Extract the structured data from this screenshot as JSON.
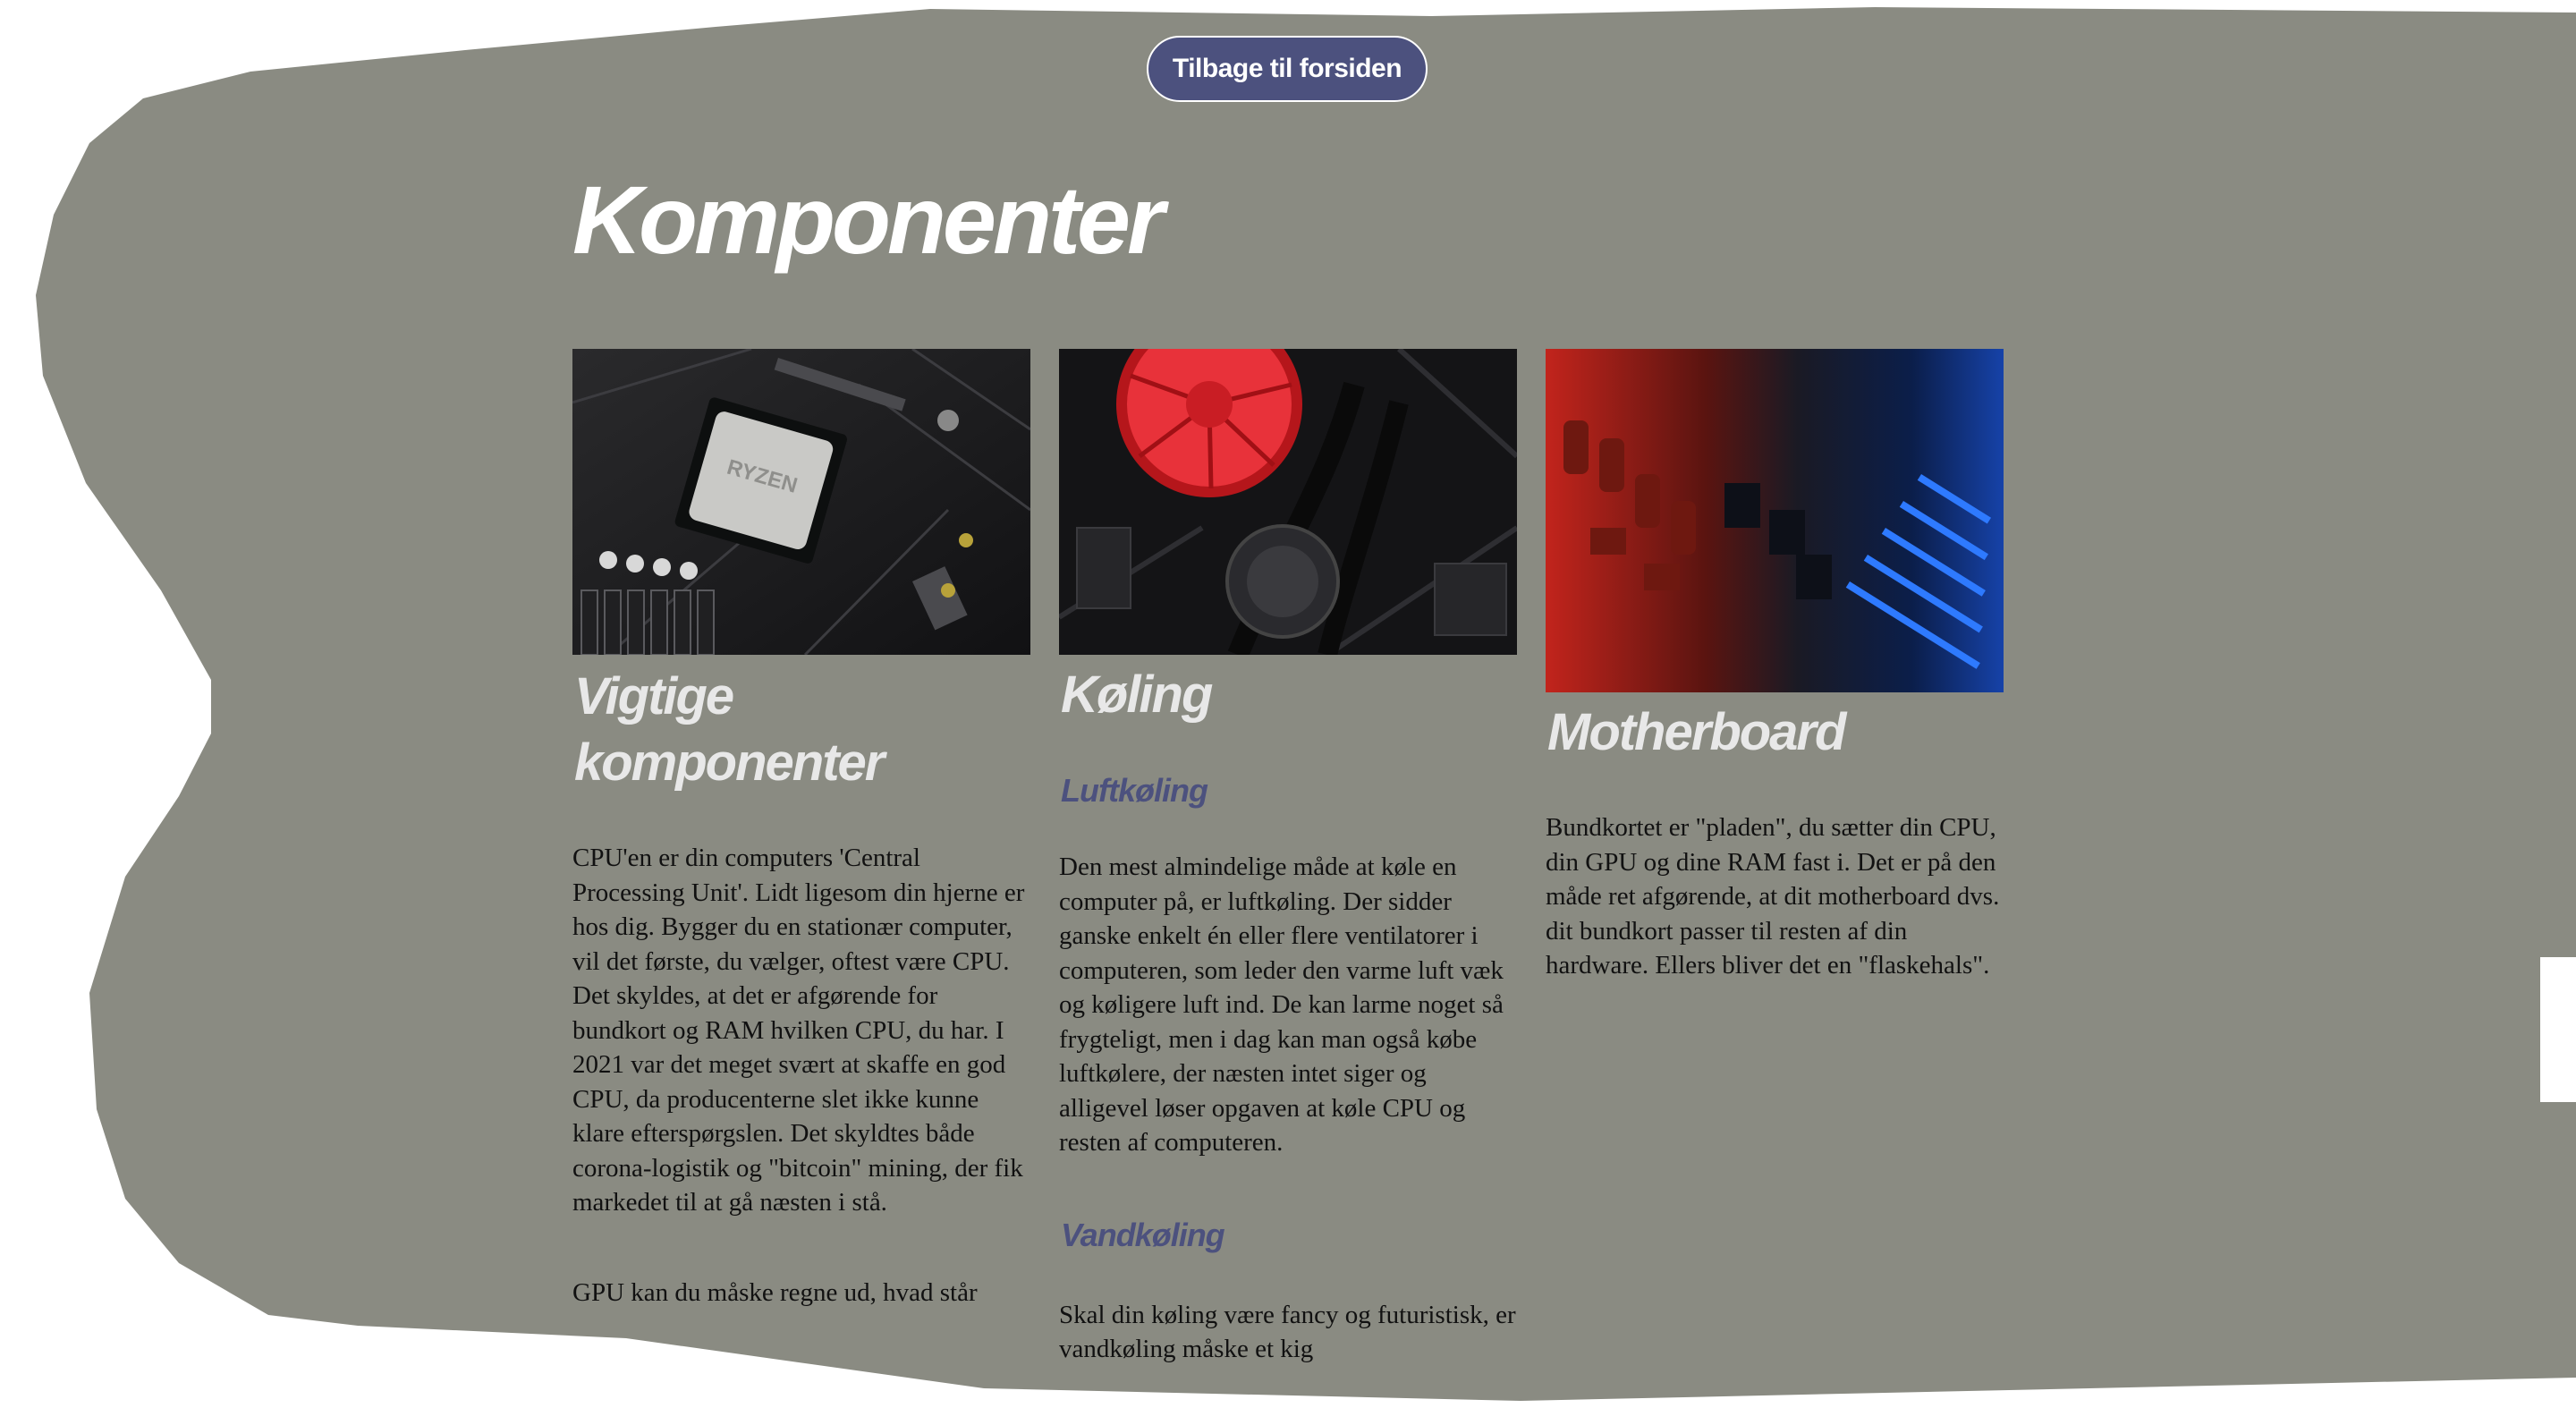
{
  "colors": {
    "background_blob": "#8a8b82",
    "page": "#ffffff",
    "button": "#4c517e",
    "heading": "#e8e8e8",
    "subheading": "#4c517e",
    "body_text": "#111111"
  },
  "nav": {
    "back_label": "Tilbage til forsiden"
  },
  "page": {
    "title": "Komponenter"
  },
  "columns": [
    {
      "image": "cpu-motherboard-photo",
      "heading": "Vigtige komponenter",
      "paragraphs": [
        "CPU'en er din computers 'Central Processing Unit'. Lidt ligesom din hjerne er hos dig. Bygger du en stationær computer, vil det første, du vælger, oftest være CPU. Det skyldes, at det er afgørende for bundkort og RAM hvilken CPU, du har. I 2021 var det meget svært at skaffe en god CPU, da producenterne slet ikke kunne klare efterspørgslen. Det skyldtes både corona-logistik og \"bitcoin\" mining, der fik markedet til at gå næsten i stå.",
        "GPU kan du måske regne ud, hvad står"
      ]
    },
    {
      "image": "red-cpu-cooler-photo",
      "heading": "Køling",
      "sub1": "Luftkøling",
      "p1": "Den mest almindelige måde at køle en computer på, er luftkøling. Der sidder ganske enkelt én eller flere ventilatorer i computeren, som leder den varme luft væk og køligere luft ind. De kan larme noget så frygteligt, men i dag kan man også købe luftkølere, der næsten intet siger og alligevel løser opgaven at køle CPU og resten af computeren.",
      "sub2": "Vandkøling",
      "p2": "Skal din køling være fancy og futuristisk, er vandkøling måske et kig"
    },
    {
      "image": "red-blue-circuit-board-photo",
      "heading": "Motherboard",
      "paragraphs": [
        "Bundkortet er \"pladen\", du sætter din CPU, din GPU og dine RAM fast i. Det er på den måde ret afgørende, at dit motherboard dvs. dit bundkort passer til resten af din hardware. Ellers bliver det en \"flaskehals\"."
      ]
    }
  ]
}
